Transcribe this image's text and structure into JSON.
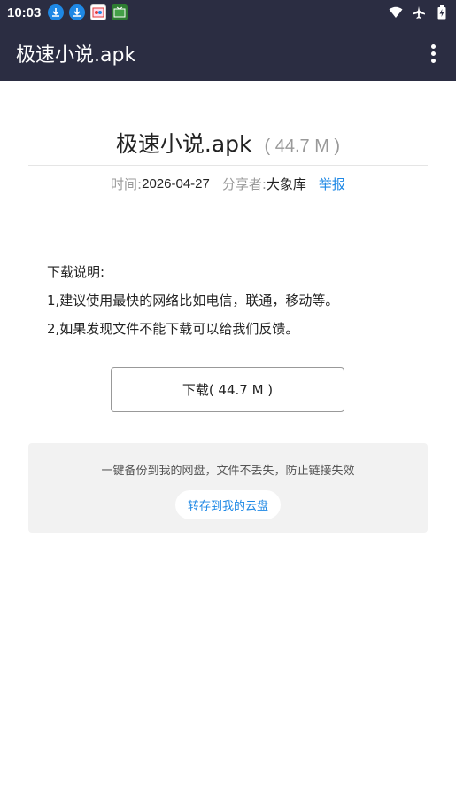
{
  "status_bar": {
    "time": "10:03",
    "notification_icons": [
      "download-icon",
      "download-icon",
      "app-notification-icon",
      "tv-app-icon"
    ],
    "system_icons": [
      "wifi-icon",
      "airplane-mode-icon",
      "battery-charging-icon"
    ]
  },
  "app_bar": {
    "title": "极速小说.apk"
  },
  "file": {
    "name": "极速小说.apk",
    "size": "( 44.7 M )",
    "time_label": "时间: ",
    "time_value": "2026-04-27",
    "sharer_label": "分享者: ",
    "sharer_value": "大象库",
    "report_label": "举报"
  },
  "instructions": {
    "heading": "下载说明:",
    "lines": [
      "1,建议使用最快的网络比如电信，联通，移动等。",
      "2,如果发现文件不能下载可以给我们反馈。"
    ]
  },
  "download_button": {
    "label": "下载( 44.7 M )"
  },
  "save_panel": {
    "description": "一键备份到我的网盘，文件不丢失，防止链接失效",
    "button_label": "转存到我的云盘"
  },
  "colors": {
    "bar_background": "#2b2d42",
    "link_blue": "#1e88e5",
    "panel_background": "#f2f2f2"
  }
}
